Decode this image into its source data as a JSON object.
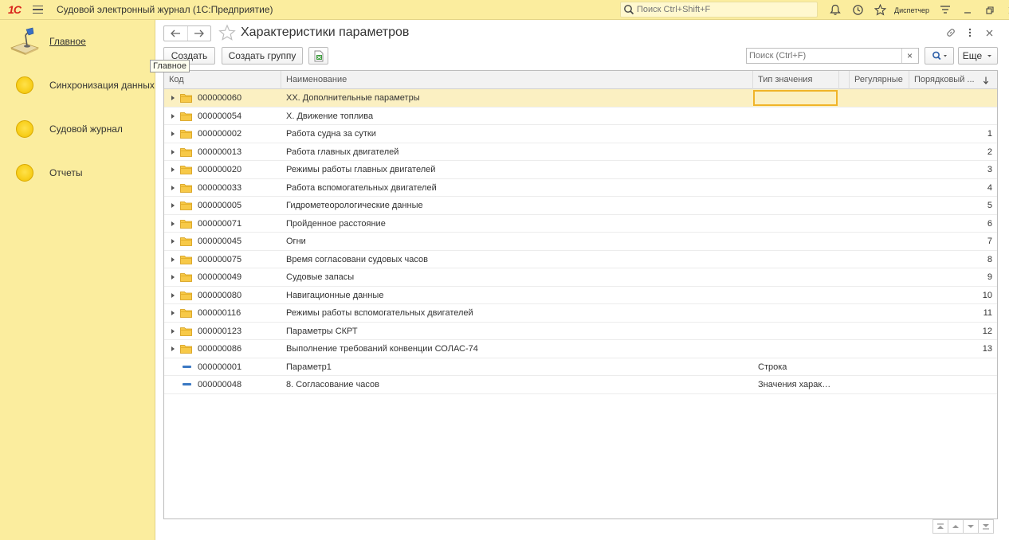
{
  "app": {
    "logo": "1С",
    "title": "Судовой электронный журнал  (1С:Предприятие)",
    "search_placeholder": "Поиск Ctrl+Shift+F",
    "user": "Диспетчер"
  },
  "sidebar": {
    "items": [
      {
        "label": "Главное",
        "icon": "desk-lamp-icon",
        "active": true
      },
      {
        "label": "Синхронизация данных",
        "icon": "yellow-circle-icon"
      },
      {
        "label": "Судовой журнал",
        "icon": "yellow-circle-icon"
      },
      {
        "label": "Отчеты",
        "icon": "yellow-circle-icon"
      }
    ],
    "tooltip": "Главное"
  },
  "form": {
    "title": "Характеристики параметров",
    "create_label": "Создать",
    "create_group_label": "Создать группу",
    "search_placeholder": "Поиск (Ctrl+F)",
    "clear_label": "×",
    "more_label": "Еще"
  },
  "table": {
    "columns": [
      "Код",
      "Наименование",
      "Тип значения",
      "Регулярные",
      "Порядковый ..."
    ],
    "rows": [
      {
        "code": "000000060",
        "name": "XX. Дополнительные параметры",
        "type": "",
        "order": "",
        "group": true,
        "selected": true
      },
      {
        "code": "000000054",
        "name": "X. Движение топлива",
        "type": "",
        "order": "",
        "group": true
      },
      {
        "code": "000000002",
        "name": "Работа судна за сутки",
        "type": "",
        "order": "1",
        "group": true
      },
      {
        "code": "000000013",
        "name": "Работа главных двигателей",
        "type": "",
        "order": "2",
        "group": true
      },
      {
        "code": "000000020",
        "name": "Режимы работы главных двигателей",
        "type": "",
        "order": "3",
        "group": true
      },
      {
        "code": "000000033",
        "name": "Работа вспомогательных двигателей",
        "type": "",
        "order": "4",
        "group": true
      },
      {
        "code": "000000005",
        "name": "Гидрометеорологические данные",
        "type": "",
        "order": "5",
        "group": true
      },
      {
        "code": "000000071",
        "name": "Пройденное расстояние",
        "type": "",
        "order": "6",
        "group": true
      },
      {
        "code": "000000045",
        "name": "Огни",
        "type": "",
        "order": "7",
        "group": true
      },
      {
        "code": "000000075",
        "name": "Время согласовани судовых часов",
        "type": "",
        "order": "8",
        "group": true
      },
      {
        "code": "000000049",
        "name": "Судовые запасы",
        "type": "",
        "order": "9",
        "group": true
      },
      {
        "code": "000000080",
        "name": "Навигационные данные",
        "type": "",
        "order": "10",
        "group": true
      },
      {
        "code": "000000116",
        "name": "Режимы работы вспомогательных двигателей",
        "type": "",
        "order": "11",
        "group": true
      },
      {
        "code": "000000123",
        "name": "Параметры СКРТ",
        "type": "",
        "order": "12",
        "group": true
      },
      {
        "code": "000000086",
        "name": "Выполнение требований конвенции СОЛАС-74",
        "type": "",
        "order": "13",
        "group": true
      },
      {
        "code": "000000001",
        "name": "Параметр1",
        "type": "Строка",
        "order": "",
        "group": false
      },
      {
        "code": "000000048",
        "name": "8. Согласование часов",
        "type": "Значения харак…",
        "order": "",
        "group": false
      }
    ]
  },
  "colors": {
    "panel_bg": "#fbed9e",
    "selected_row": "#fbf0c2",
    "focus_border": "#f0b429",
    "logo_red": "#d9251c"
  }
}
